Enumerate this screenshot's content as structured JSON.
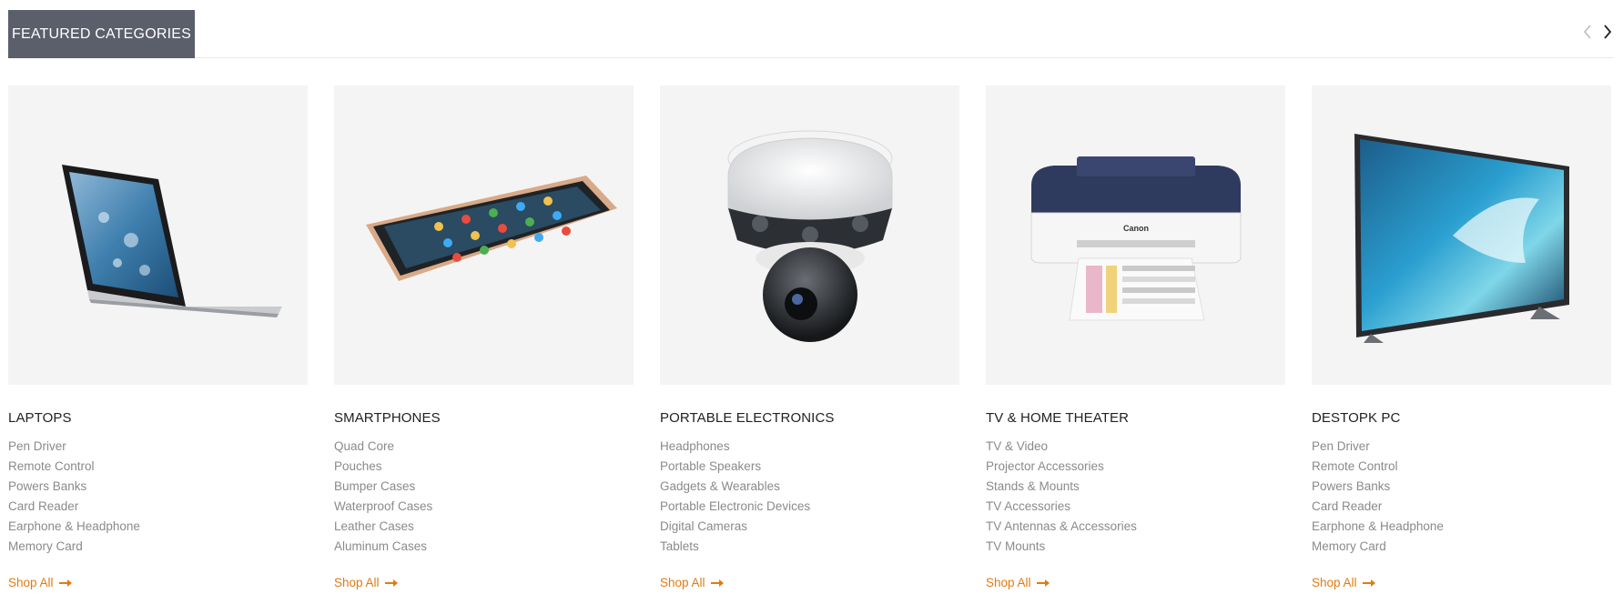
{
  "header": {
    "title": "FEATURED CATEGORIES",
    "prev_icon": "chevron-left-icon",
    "next_icon": "chevron-right-icon"
  },
  "categories": [
    {
      "title": "LAPTOPS",
      "image": "laptop-image",
      "links": [
        "Pen Driver",
        "Remote Control",
        "Powers Banks",
        "Card Reader",
        "Earphone & Headphone",
        "Memory Card"
      ],
      "shop_all": "Shop All"
    },
    {
      "title": "SMARTPHONES",
      "image": "smartphone-image",
      "links": [
        "Quad Core",
        "Pouches",
        "Bumper Cases",
        "Waterproof Cases",
        "Leather Cases",
        "Aluminum Cases"
      ],
      "shop_all": "Shop All"
    },
    {
      "title": "PORTABLE ELECTRONICS",
      "image": "security-camera-image",
      "links": [
        "Headphones",
        "Portable Speakers",
        "Gadgets & Wearables",
        "Portable Electronic Devices",
        "Digital Cameras",
        "Tablets"
      ],
      "shop_all": "Shop All"
    },
    {
      "title": "TV & HOME THEATER",
      "image": "printer-image",
      "links": [
        "TV & Video",
        "Projector Accessories",
        "Stands & Mounts",
        "TV Accessories",
        "TV Antennas & Accessories",
        "TV Mounts"
      ],
      "shop_all": "Shop All"
    },
    {
      "title": "DESTOPK PC",
      "image": "television-image",
      "links": [
        "Pen Driver",
        "Remote Control",
        "Powers Banks",
        "Card Reader",
        "Earphone & Headphone",
        "Memory Card"
      ],
      "shop_all": "Shop All"
    }
  ],
  "colors": {
    "header_bg": "#5b5f6b",
    "accent": "#e07b10",
    "link": "#8a8a8a",
    "thumb_bg": "#f4f4f4"
  },
  "printer_brand": "Canon"
}
